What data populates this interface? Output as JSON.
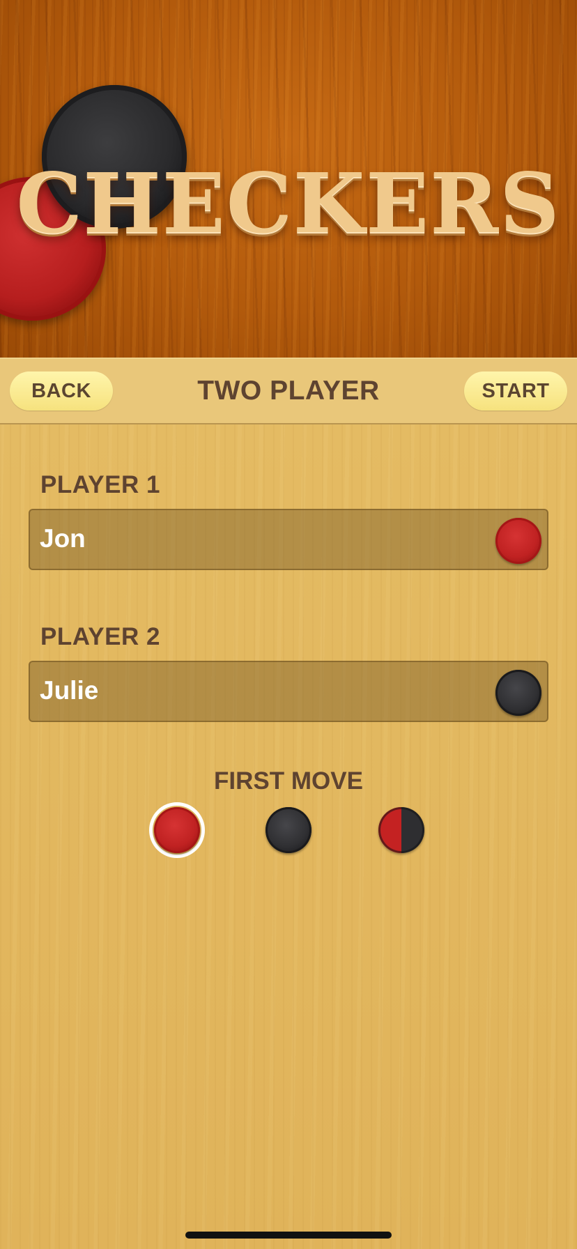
{
  "banner": {
    "title": "CHECKERS"
  },
  "navbar": {
    "back_label": "BACK",
    "title": "TWO PLAYER",
    "start_label": "START"
  },
  "players": [
    {
      "label": "PLAYER 1",
      "name": "Jon",
      "piece_color": "red"
    },
    {
      "label": "PLAYER 2",
      "name": "Julie",
      "piece_color": "black"
    }
  ],
  "first_move": {
    "title": "FIRST MOVE",
    "options": [
      "red",
      "black",
      "random"
    ],
    "selected": "red"
  },
  "colors": {
    "wood_dark": "#b25a0c",
    "panel_wood": "#e2b75e",
    "pill_button": "#f6e27e",
    "text_brown": "#5e4330",
    "piece_red": "#c02222",
    "piece_black": "#303033"
  }
}
